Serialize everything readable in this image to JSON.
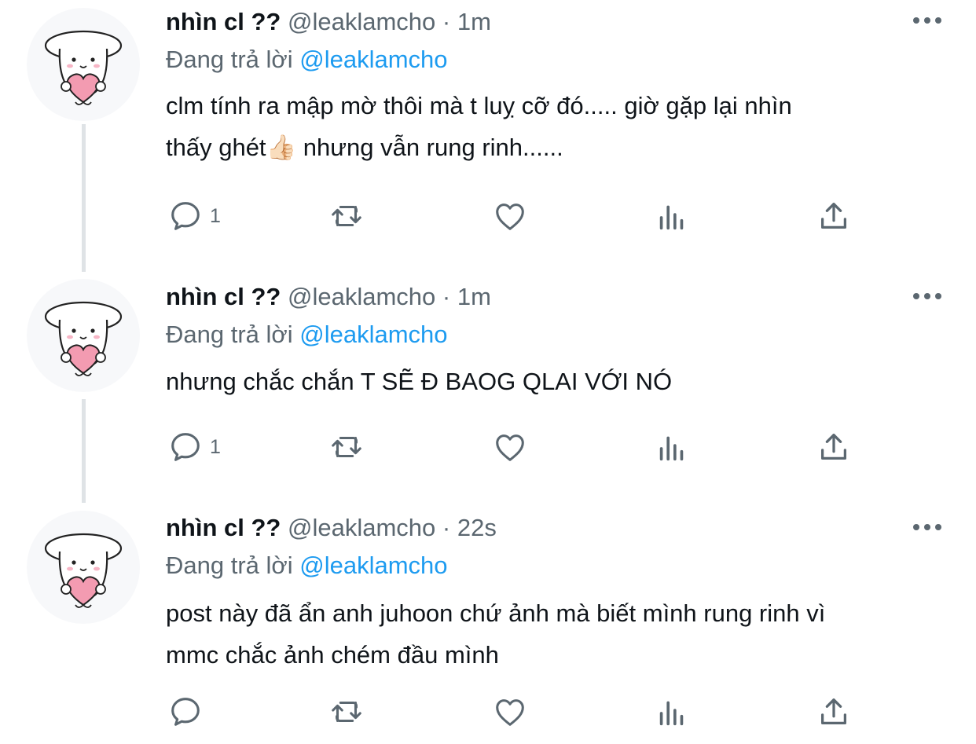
{
  "tweets": [
    {
      "name": "nhìn cl ??",
      "handle": "@leaklamcho",
      "separator": "·",
      "time": "1m",
      "reply_prefix": "Đang trả lời",
      "reply_to": "@leaklamcho",
      "text_lines": [
        "clm tính ra mập mờ thôi mà t luỵ cỡ đó..... giờ gặp lại nhìn",
        "thấy ghét👍🏻 nhưng vẫn rung rinh......"
      ],
      "reply_count": "1"
    },
    {
      "name": "nhìn cl ??",
      "handle": "@leaklamcho",
      "separator": "·",
      "time": "1m",
      "reply_prefix": "Đang trả lời",
      "reply_to": "@leaklamcho",
      "text_lines": [
        "nhưng chắc chắn T SẼ Đ BAOG QLAI VỚI NÓ"
      ],
      "reply_count": "1"
    },
    {
      "name": "nhìn cl ??",
      "handle": "@leaklamcho",
      "separator": "·",
      "time": "22s",
      "reply_prefix": "Đang trả lời",
      "reply_to": "@leaklamcho",
      "text_lines": [
        "post này đã ẩn anh juhoon chứ ảnh mà biết mình rung rinh vì",
        "mmc chắc ảnh chém đầu mình"
      ],
      "reply_count": ""
    }
  ],
  "icons": {
    "more": "more-horizontal-icon",
    "reply": "reply-icon",
    "retweet": "retweet-icon",
    "like": "heart-icon",
    "views": "views-chart-icon",
    "share": "share-icon",
    "avatar": "dog-holding-heart-avatar"
  },
  "colors": {
    "text": "#0f1419",
    "secondary": "#5b6770",
    "mention": "#1d9bf0",
    "thread_line": "#dfe3e6",
    "heart": "#f39bb1"
  }
}
